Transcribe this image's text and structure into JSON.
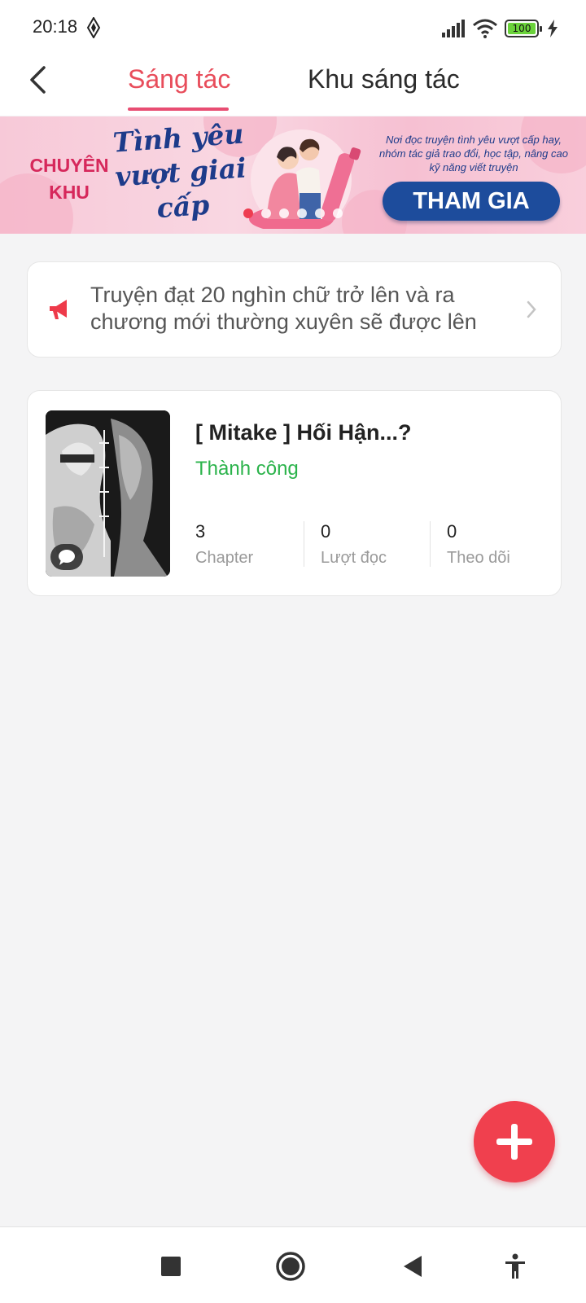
{
  "status_bar": {
    "time": "20:18",
    "battery": "100"
  },
  "header": {
    "tabs": [
      {
        "label": "Sáng tác",
        "active": true
      },
      {
        "label": "Khu sáng tác",
        "active": false
      }
    ]
  },
  "banner": {
    "prefix": "CHUYÊN KHU",
    "title": "Tình yêu vượt giai cấp",
    "description": "Nơi đọc truyện tình yêu vượt cấp hay, nhóm tác giả trao đổi, học tập, nâng cao kỹ năng viết truyện",
    "button": "THAM GIA",
    "slide_count": 6,
    "active_slide": 1
  },
  "notice": {
    "text": "Truyện đạt 20 nghìn chữ trở lên và ra chương mới thường xuyên sẽ được lên"
  },
  "stories": [
    {
      "title": "[ Mitake ] Hối Hận...?",
      "status": "Thành công",
      "stats": [
        {
          "value": "3",
          "label": "Chapter"
        },
        {
          "value": "0",
          "label": "Lượt đọc"
        },
        {
          "value": "0",
          "label": "Theo dõi"
        }
      ]
    }
  ],
  "colors": {
    "accent": "#e84d5b",
    "success": "#2bb34b",
    "fab": "#f0404e",
    "banner_blue": "#1d4c9c"
  },
  "icons": {
    "back": "chevron-left-icon",
    "notice": "megaphone-icon",
    "notice_chevron": "chevron-right-icon",
    "comment": "comment-icon",
    "fab": "plus-icon",
    "nav": [
      "square-icon",
      "home-circle-icon",
      "back-triangle-icon",
      "accessibility-icon"
    ]
  }
}
